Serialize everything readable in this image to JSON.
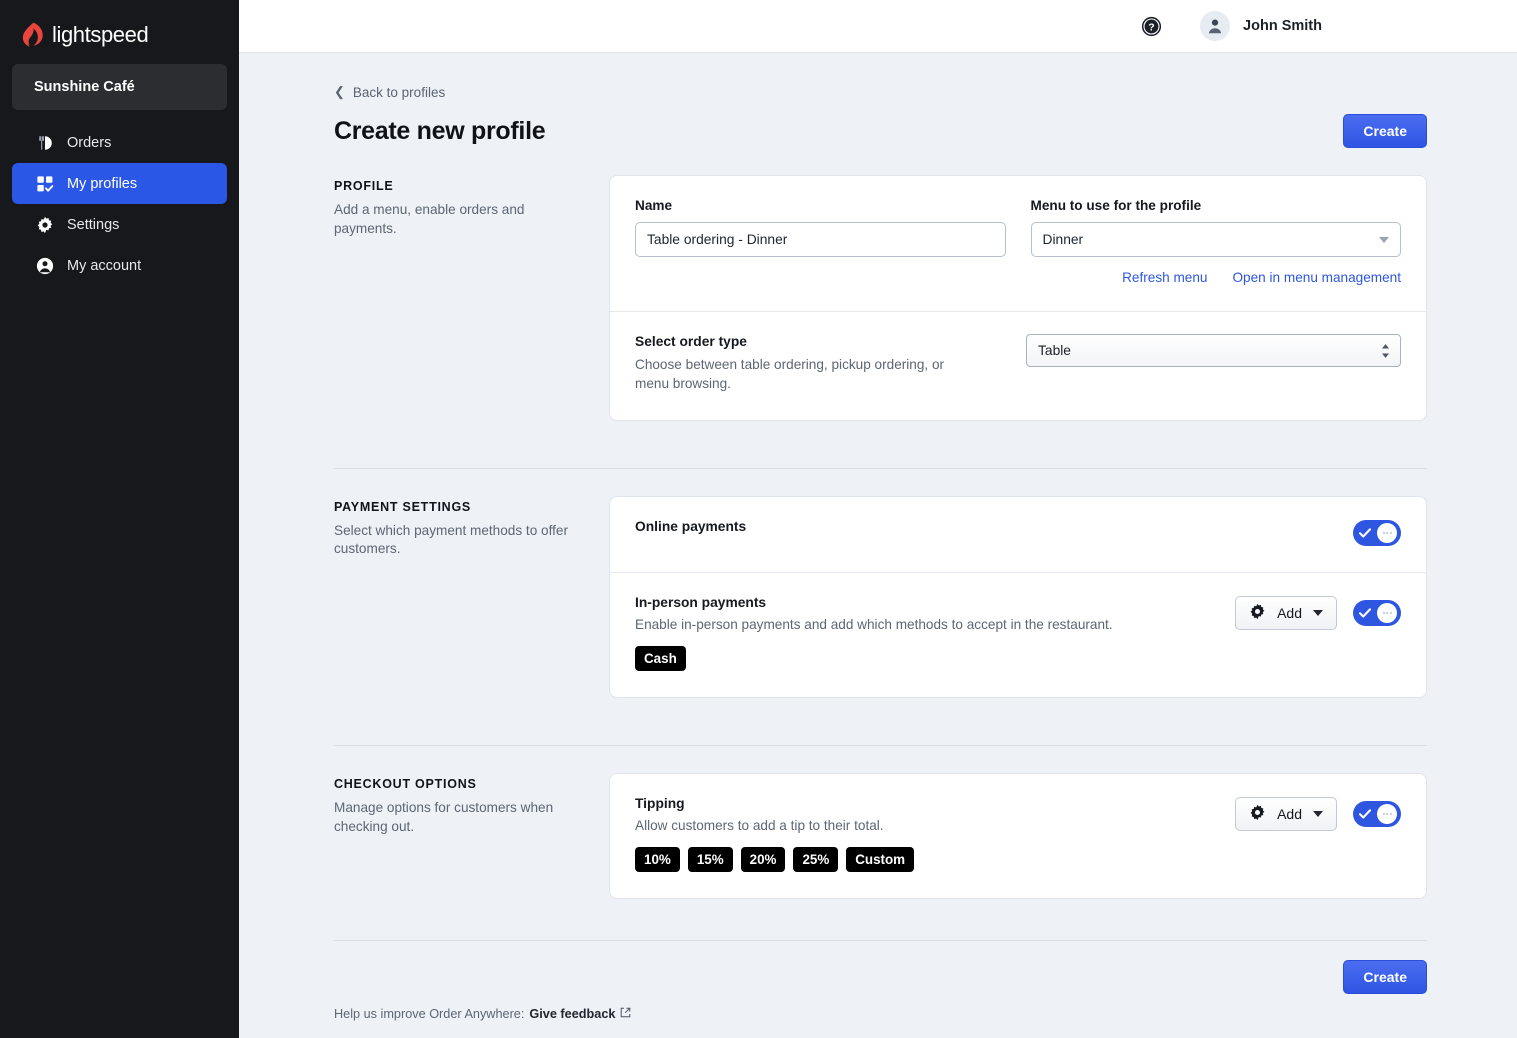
{
  "brand": {
    "logo_text": "lightspeed",
    "logo_color": "#e8463c"
  },
  "sidebar": {
    "store_name": "Sunshine Café",
    "items": [
      {
        "label": "Orders",
        "icon": "orders-icon",
        "active": false
      },
      {
        "label": "My profiles",
        "icon": "profiles-icon",
        "active": true
      },
      {
        "label": "Settings",
        "icon": "gear-icon",
        "active": false
      },
      {
        "label": "My account",
        "icon": "user-circle-icon",
        "active": false
      }
    ]
  },
  "topbar": {
    "help_icon": "help-circle-icon",
    "avatar_icon": "user-avatar-icon",
    "user_name": "John Smith"
  },
  "header": {
    "back_label": "Back to profiles",
    "title": "Create new profile",
    "create_label": "Create"
  },
  "profile_section": {
    "kicker": "PROFILE",
    "description": "Add a menu, enable orders and payments.",
    "name_label": "Name",
    "name_value": "Table ordering - Dinner",
    "name_placeholder": "Name",
    "menu_label": "Menu to use for the profile",
    "menu_value": "Dinner",
    "refresh_link": "Refresh menu",
    "manage_link": "Open in menu management",
    "order_type_title": "Select order type",
    "order_type_desc": "Choose between table ordering, pickup ordering, or menu browsing.",
    "order_type_value": "Table"
  },
  "payment_section": {
    "kicker": "PAYMENT SETTINGS",
    "description": "Select which payment methods to offer customers.",
    "online": {
      "title": "Online payments",
      "toggle_state": "on"
    },
    "in_person": {
      "title": "In-person payments",
      "description": "Enable in-person payments and add which methods to accept in the restaurant.",
      "add_label": "Add",
      "toggle_state": "on",
      "methods": [
        "Cash"
      ]
    }
  },
  "checkout_section": {
    "kicker": "CHECKOUT OPTIONS",
    "description": "Manage options for customers when checking out.",
    "tipping": {
      "title": "Tipping",
      "description": "Allow customers to add a tip to their total.",
      "add_label": "Add",
      "toggle_state": "on",
      "options": [
        "10%",
        "15%",
        "20%",
        "25%",
        "Custom"
      ]
    }
  },
  "footer": {
    "create_label": "Create",
    "note_prefix": "Help us improve Order Anywhere:",
    "feedback_link": "Give feedback"
  },
  "colors": {
    "accent_blue": "#2f56e0",
    "sidebar_bg": "#17181c",
    "page_bg": "#eef1f6",
    "chip_black": "#000000",
    "logo_red": "#e8463c"
  }
}
